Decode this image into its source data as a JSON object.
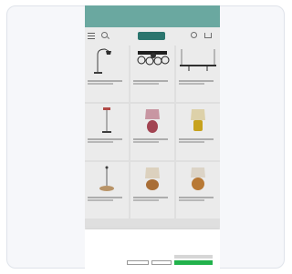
{
  "frame": {
    "accent": "#6aa8a0"
  },
  "header": {
    "logo_text": "",
    "menu_icon": "menu-icon",
    "search_icon": "search-icon",
    "account_icon": "account-icon",
    "cart_icon": "cart-icon"
  },
  "products": [
    {
      "name": "",
      "price": "",
      "image": "arc-floor-lamp"
    },
    {
      "name": "",
      "price": "",
      "image": "ceiling-spotlight-cluster"
    },
    {
      "name": "",
      "price": "",
      "image": "pendant-bar-lamp"
    },
    {
      "name": "",
      "price": "",
      "image": "slim-floor-lamp"
    },
    {
      "name": "",
      "price": "",
      "image": "pink-shade-table-lamp"
    },
    {
      "name": "",
      "price": "",
      "image": "yellow-shade-table-lamp"
    },
    {
      "name": "",
      "price": "",
      "image": "tripod-floor-lamp"
    },
    {
      "name": "",
      "price": "",
      "image": "wood-base-table-lamp"
    },
    {
      "name": "",
      "price": "",
      "image": "amber-base-table-lamp"
    }
  ],
  "cookie_banner": {
    "title": "",
    "body": "",
    "link": "",
    "settings_label": "",
    "reject_label": "",
    "alt_label": "",
    "accept_label": "",
    "accept_color": "#22b24c"
  }
}
